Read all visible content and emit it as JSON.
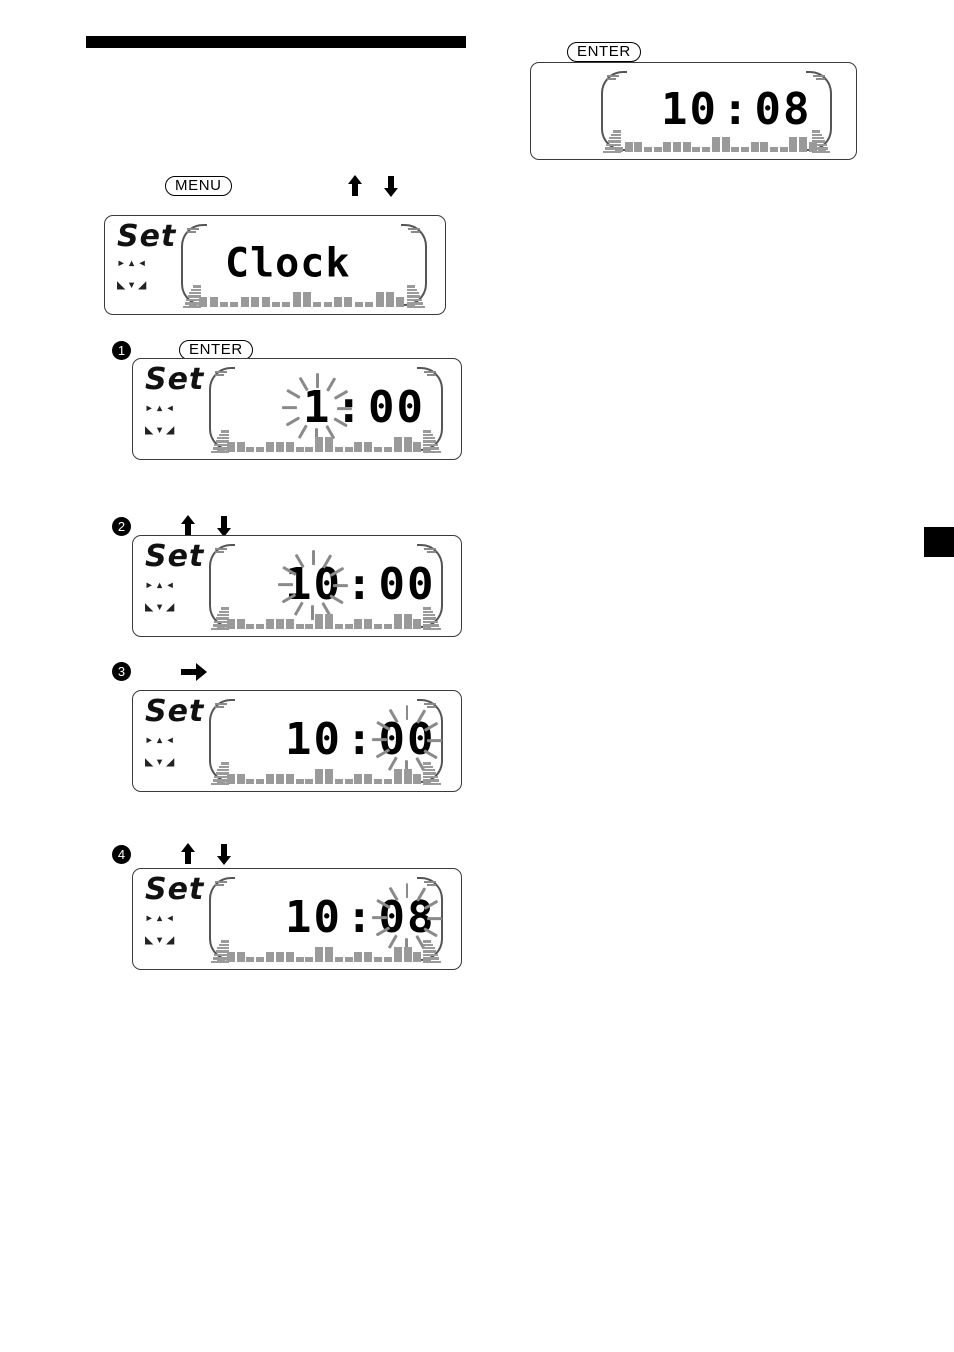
{
  "page": {
    "title_rule": "",
    "edge_tab": "chapter-marker",
    "accent_color": "#000000",
    "spectrum_color": "#9a9a9a"
  },
  "buttons": {
    "menu": "MENU",
    "enter": "ENTER"
  },
  "icons": {
    "arrow_up": "arrow-up-icon",
    "arrow_down": "arrow-down-icon",
    "arrow_right": "arrow-right-icon"
  },
  "result_display": {
    "enter_label": "ENTER",
    "time": "10:08",
    "hours": "10",
    "colon": ":",
    "minutes": "08",
    "set_label": "",
    "flashing": "none"
  },
  "menu_display": {
    "menu_label": "MENU",
    "set_label": "Set",
    "set_sub_1": "▸▴◂",
    "set_sub_2": "◣▾◢",
    "text": "Clock"
  },
  "steps": [
    {
      "number": "1",
      "control": "ENTER",
      "control_type": "pill",
      "set_label": "Set",
      "hours": "1",
      "colon": ":",
      "minutes": "00",
      "flashing": "hours"
    },
    {
      "number": "2",
      "control": "",
      "control_type": "updown",
      "set_label": "Set",
      "hours": "10",
      "colon": ":",
      "minutes": "00",
      "flashing": "hours"
    },
    {
      "number": "3",
      "control": "",
      "control_type": "right",
      "set_label": "Set",
      "hours": "10",
      "colon": ":",
      "minutes": "00",
      "flashing": "minutes"
    },
    {
      "number": "4",
      "control": "",
      "control_type": "updown",
      "set_label": "Set",
      "hours": "10",
      "colon": ":",
      "minutes": "08",
      "flashing": "minutes"
    }
  ]
}
